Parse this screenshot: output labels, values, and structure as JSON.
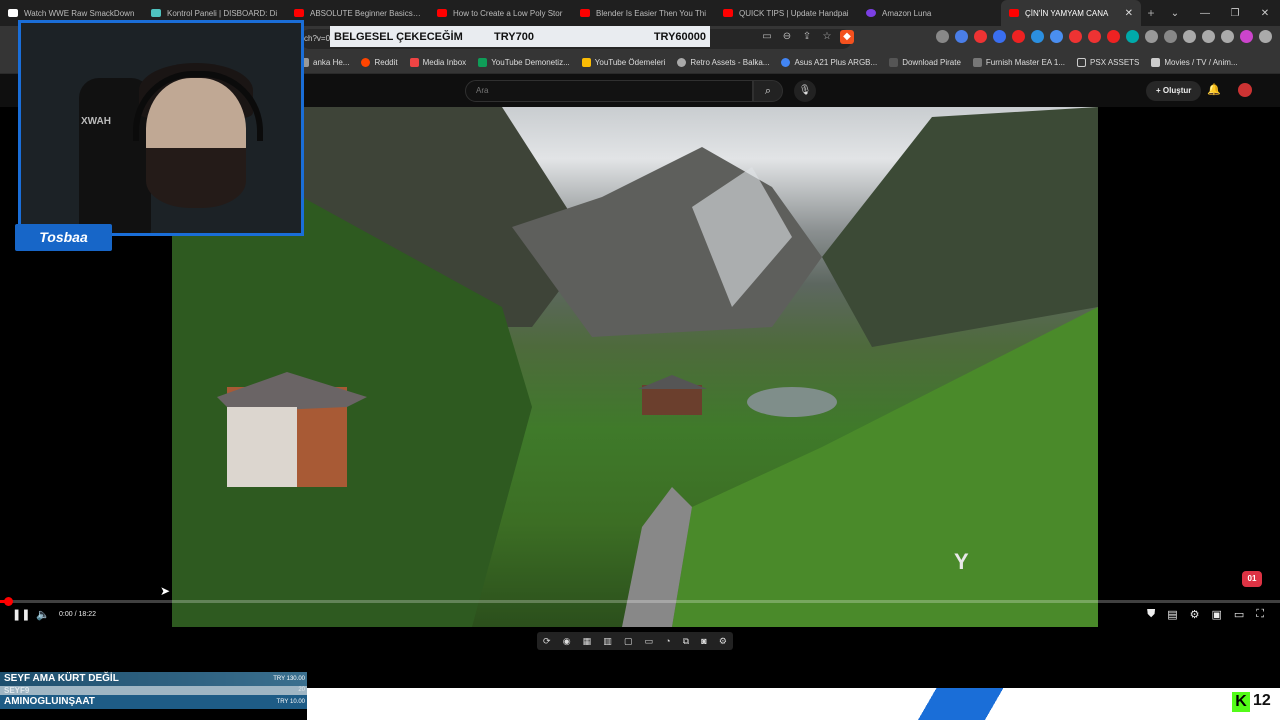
{
  "tabs": [
    {
      "label": "Watch WWE Raw SmackDown",
      "color": "#ffffff"
    },
    {
      "label": "Kontrol Paneli | DISBOARD: Di",
      "color": "#4fc3c0"
    },
    {
      "label": "ABSOLUTE Beginner Basics.. B",
      "color": "#ff0000"
    },
    {
      "label": "How to Create a Low Poly Stor",
      "color": "#ff0000"
    },
    {
      "label": "Blender Is Easier Then You Thi",
      "color": "#ff0000"
    },
    {
      "label": "QUICK TIPS | Update Handpai",
      "color": "#ff0000"
    },
    {
      "label": "Amazon Luna",
      "color": "#7b3fe4"
    },
    {
      "label": "ÇİN'İN YAMYAM CANA",
      "color": "#ff0000",
      "active": true
    }
  ],
  "url_fragment": "ch?v=0",
  "bookmarks": [
    {
      "label": "anka He...",
      "color": "#999"
    },
    {
      "label": "Reddit",
      "color": "#ff4500"
    },
    {
      "label": "Media Inbox",
      "color": "#e44"
    },
    {
      "label": "YouTube Demonetiz...",
      "color": "#0f9d58"
    },
    {
      "label": "YouTube Ödemeleri",
      "color": "#fbbc05"
    },
    {
      "label": "Retro Assets - Balka...",
      "color": "#aaa"
    },
    {
      "label": "Asus A21 Plus ARGB...",
      "color": "#4285f4"
    },
    {
      "label": "Download Pirate",
      "color": "#aaa"
    },
    {
      "label": "Furnish Master EA 1...",
      "color": "#aaa"
    },
    {
      "label": "PSX ASSETS",
      "color": "#aaa"
    },
    {
      "label": "Movies / TV / Anim...",
      "color": "#aaa"
    }
  ],
  "youtube": {
    "search_placeholder": "Ara",
    "create_label": "Oluştur"
  },
  "player": {
    "time": "0:00 / 18:22",
    "progress_fraction": 0.005,
    "watermark": "Y"
  },
  "stream": {
    "streamer_name": "Tosbaa",
    "donation_name": "BELGESEL ÇEKECEĞİM",
    "donation_amount": "TRY700",
    "donation_goal": "TRY60000",
    "tickers": [
      {
        "name": "SEYF AMA KÜRT DEĞİL",
        "amount": "TRY 130.00"
      },
      {
        "name": "SEYF9",
        "amount": "20"
      },
      {
        "name": "AMINOGLUINŞAAT",
        "amount": "TRY 10.00"
      }
    ],
    "viewer_count": "12",
    "chair_text": "XWAH"
  }
}
